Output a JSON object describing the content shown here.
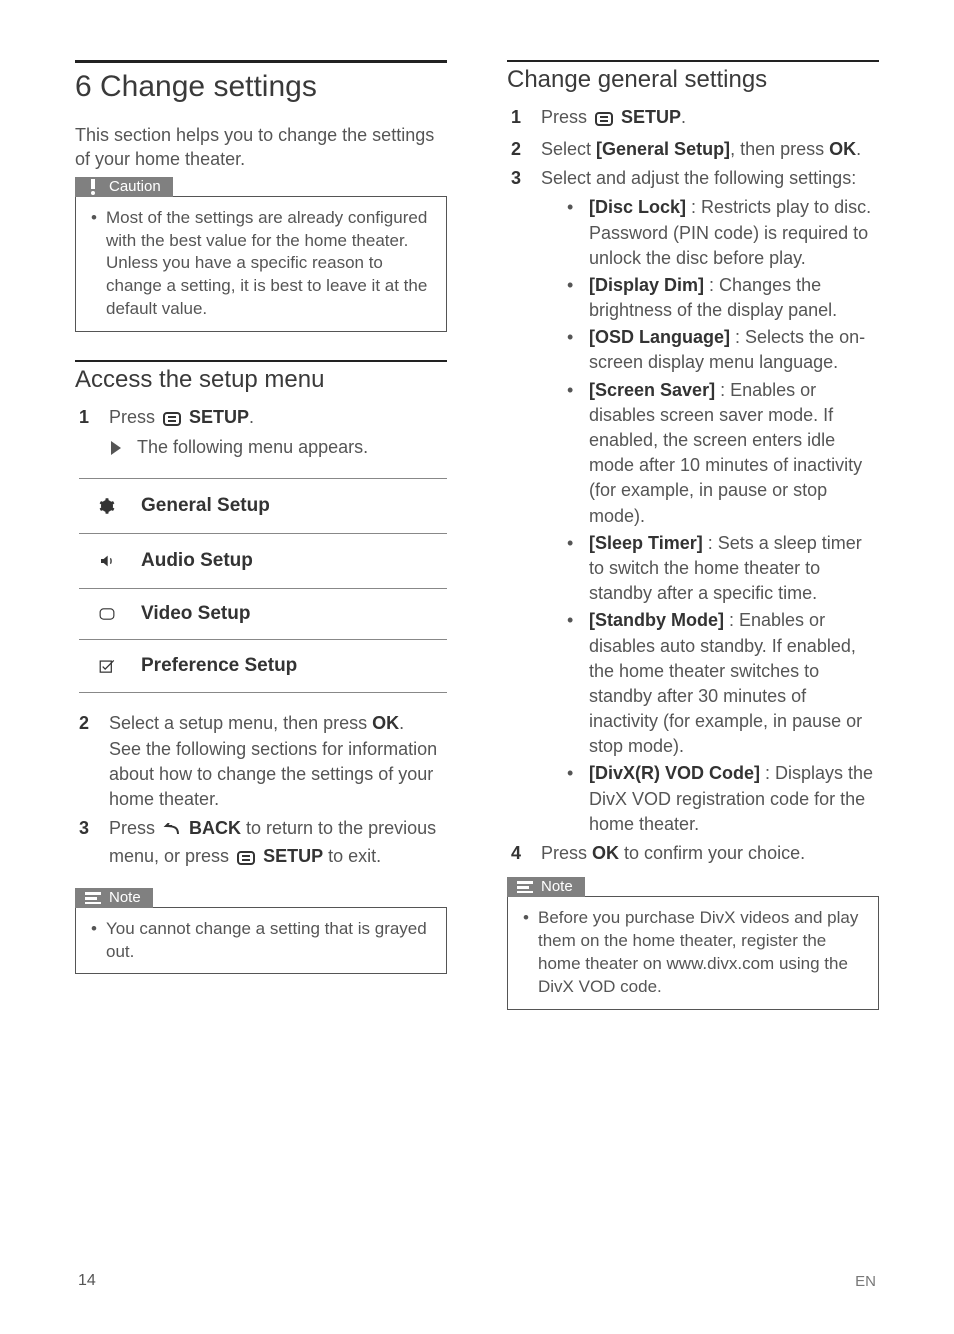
{
  "left": {
    "section_title": "6 Change settings",
    "intro": "This section helps you to change the settings of your home theater.",
    "caution_label": "Caution",
    "caution_body": "Most of the settings are already configured with the best value for the home theater. Unless you have a specific reason to change a setting, it is best to leave it at the default value.",
    "access_heading": "Access the setup menu",
    "step1_a": "Press ",
    "step1_b": " SETUP",
    "step1_c": ".",
    "step1_result": "The following menu appears.",
    "menu_items": [
      "General Setup",
      "Audio Setup",
      "Video Setup",
      "Preference Setup"
    ],
    "step2_a": "Select a setup menu, then press ",
    "step2_b": "OK",
    "step2_c": ".",
    "step2_desc": "See the following sections for information about how to change the settings of your home theater.",
    "step3_a": "Press ",
    "step3_b": " BACK",
    "step3_c": " to return to the previous menu, or press ",
    "step3_d": " SETUP",
    "step3_e": " to exit.",
    "note_label": "Note",
    "note_body": "You cannot change a setting that is grayed out."
  },
  "right": {
    "heading": "Change general settings",
    "step1_a": "Press ",
    "step1_b": " SETUP",
    "step1_c": ".",
    "step2_a": "Select ",
    "step2_b": "[General Setup]",
    "step2_c": ", then press ",
    "step2_d": "OK",
    "step2_e": ".",
    "step3": "Select and adjust the following settings:",
    "settings": [
      {
        "name": "[Disc Lock]",
        "desc": " : Restricts play to disc. Password (PIN code) is required to unlock the disc before play."
      },
      {
        "name": "[Display Dim]",
        "desc": " : Changes the brightness of the display panel."
      },
      {
        "name": "[OSD Language]",
        "desc": " : Selects the on-screen display menu language."
      },
      {
        "name": "[Screen Saver]",
        "desc": " : Enables or disables screen saver mode. If enabled, the screen enters idle mode after 10 minutes of inactivity (for example, in pause or stop mode)."
      },
      {
        "name": "[Sleep Timer]",
        "desc": " : Sets a sleep timer to switch the home theater to standby after a specific time."
      },
      {
        "name": "[Standby Mode]",
        "desc": " : Enables or disables auto standby. If enabled, the home theater switches to standby after 30 minutes of inactivity (for example, in pause or stop mode)."
      },
      {
        "name": "[DivX(R) VOD Code]",
        "desc": " : Displays the DivX VOD registration code for the home theater."
      }
    ],
    "step4_a": "Press ",
    "step4_b": "OK",
    "step4_c": " to confirm your choice.",
    "note_label": "Note",
    "note_body": "Before you purchase DivX videos and play them on the home theater, register the home theater on www.divx.com using the DivX VOD code."
  },
  "page_number": "14",
  "footer_code": "EN"
}
